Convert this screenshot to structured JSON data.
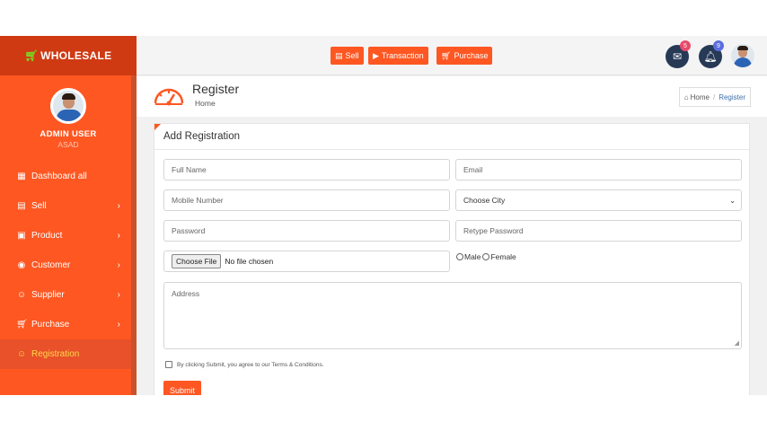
{
  "brand": {
    "name": "WHOLESALE",
    "icon": "cart-icon",
    "accent": "#fe5722"
  },
  "profile": {
    "name": "ADMIN USER",
    "role": "ASAD"
  },
  "sidebar": {
    "items": [
      {
        "label": "Dashboard all",
        "icon": "dashboard-icon",
        "has_arrow": false
      },
      {
        "label": "Sell",
        "icon": "register-icon",
        "has_arrow": true
      },
      {
        "label": "Product",
        "icon": "box-icon",
        "has_arrow": true
      },
      {
        "label": "Customer",
        "icon": "handshake-icon",
        "has_arrow": true
      },
      {
        "label": "Supplier",
        "icon": "user-icon",
        "has_arrow": true
      },
      {
        "label": "Purchase",
        "icon": "cart-icon",
        "has_arrow": true
      },
      {
        "label": "Registration",
        "icon": "user-icon",
        "has_arrow": false,
        "active": true
      }
    ]
  },
  "topbar": {
    "buttons": [
      "Sell",
      "Transaction",
      "Purchase"
    ],
    "mail_count": "5",
    "bell_count": "9"
  },
  "header": {
    "title": "Register",
    "subtitle": "Home"
  },
  "breadcrumb": {
    "home": "Home",
    "separator": "/",
    "current": "Register"
  },
  "form": {
    "title": "Add Registration",
    "full_name_placeholder": "Full Name",
    "email_placeholder": "Email",
    "mobile_placeholder": "Mobile Number",
    "city_selected": "Choose City",
    "password_placeholder": "Password",
    "retype_placeholder": "Retype Password",
    "file_button": "Choose File",
    "file_status": "No file chosen",
    "gender_male": "Male",
    "gender_female": "Female",
    "address_placeholder": "Address",
    "terms_text": "By clicking Submit, you agree to our Terms & Conditions.",
    "submit_label": "Submit"
  }
}
